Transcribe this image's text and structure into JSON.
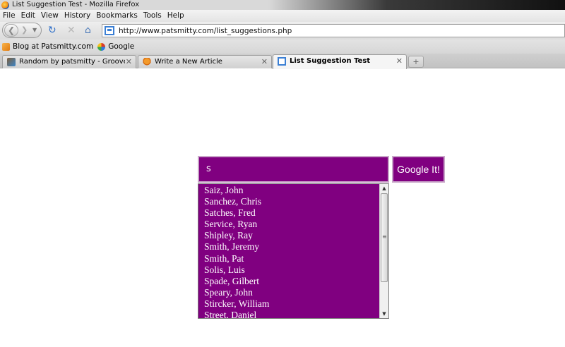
{
  "window": {
    "title": "List Suggestion Test - Mozilla Firefox"
  },
  "menu": [
    "File",
    "Edit",
    "View",
    "History",
    "Bookmarks",
    "Tools",
    "Help"
  ],
  "address": {
    "url": "http://www.patsmitty.com/list_suggestions.php"
  },
  "bookmarks": [
    {
      "label": "Blog at Patsmitty.com",
      "icon": "rss-icon"
    },
    {
      "label": "Google",
      "icon": "google-icon"
    }
  ],
  "tabs": [
    {
      "label": "Random by patsmitty - Grooveshar...",
      "active": false
    },
    {
      "label": "Write a New Article",
      "active": false
    },
    {
      "label": "List Suggestion Test",
      "active": true
    }
  ],
  "search": {
    "value": "s",
    "button_label": "Google It!"
  },
  "suggestions": [
    "Saiz, John",
    "Sanchez, Chris",
    "Satches, Fred",
    "Service, Ryan",
    "Shipley, Ray",
    "Smith, Jeremy",
    "Smith, Pat",
    "Solis, Luis",
    "Spade, Gilbert",
    "Speary, John",
    "Stircker, William",
    "Street, Daniel"
  ],
  "colors": {
    "accent": "#800080",
    "text": "#ffffff"
  }
}
